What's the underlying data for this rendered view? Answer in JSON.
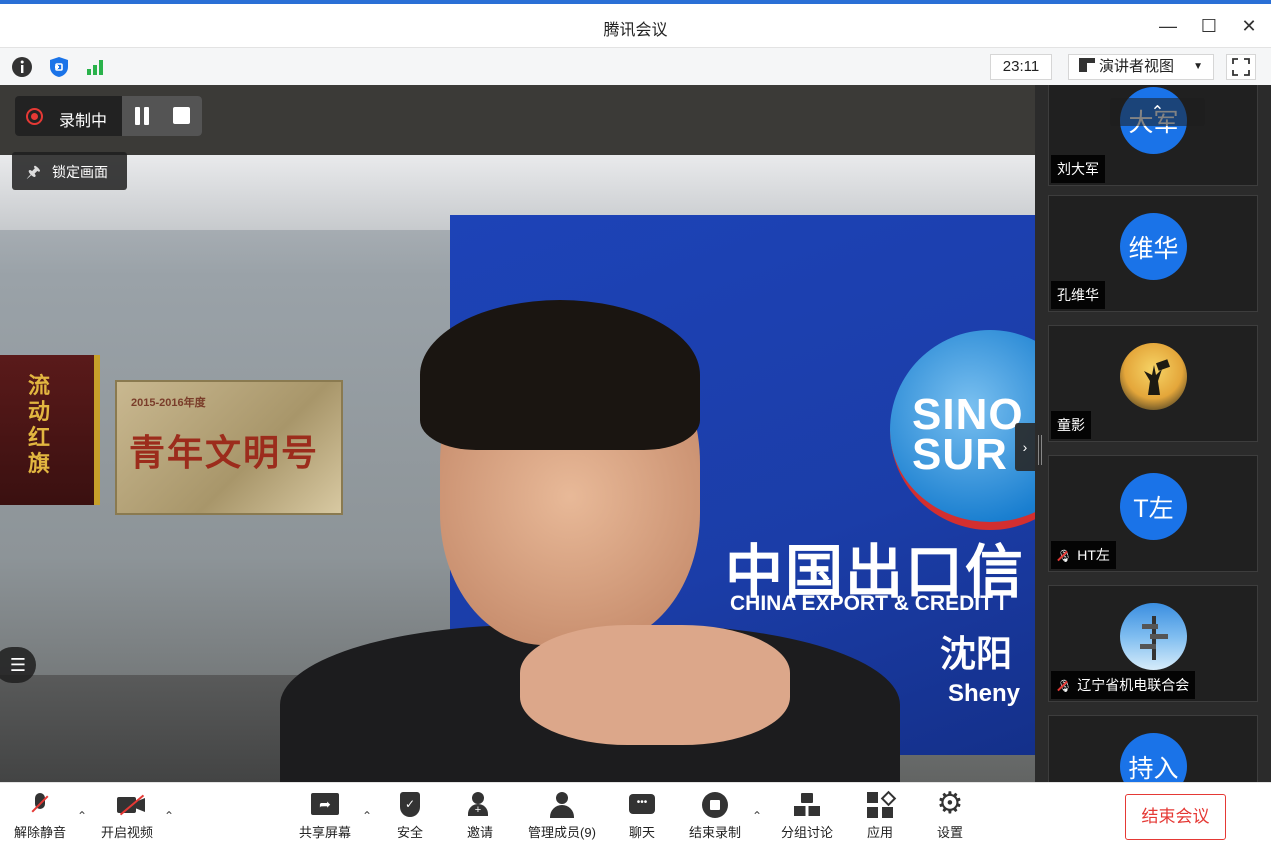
{
  "window": {
    "title": "腾讯会议",
    "minimize": "—",
    "maximize": "☐",
    "close": "✕"
  },
  "infobar": {
    "icons": [
      "info-icon",
      "shield-icon",
      "signal-icon"
    ],
    "timer": "23:11",
    "view_mode": "演讲者视图",
    "view_caret": "▼"
  },
  "stage": {
    "recording_label": "录制中",
    "lock_label": "锁定画面",
    "video_texts": {
      "globe": "SINO\nSURE",
      "cn": "中国出口信",
      "en": "CHINA EXPORT & CREDIT I",
      "city_cn": "沈阳",
      "city_en": "Sheny",
      "plaque_year": "2015-2016年度",
      "plaque_title": "青年文明号",
      "banner": "流动红旗"
    }
  },
  "participants": [
    {
      "avatar_text": "大军",
      "name": "刘大军",
      "muted": false
    },
    {
      "avatar_text": "维华",
      "name": "孔维华",
      "muted": false
    },
    {
      "avatar_text": "",
      "name": "童影",
      "muted": false,
      "avatar_image": "silhouette-sunset"
    },
    {
      "avatar_text": "T左",
      "name": "HT左",
      "muted": true
    },
    {
      "avatar_text": "",
      "name": "辽宁省机电联合会",
      "muted": true,
      "avatar_image": "signpost-sky"
    },
    {
      "avatar_text": "持入",
      "name": "",
      "muted": false
    }
  ],
  "toolbar": {
    "unmute": "解除静音",
    "start_video": "开启视频",
    "share_screen": "共享屏幕",
    "security": "安全",
    "invite": "邀请",
    "manage_members": "管理成员(9)",
    "chat": "聊天",
    "end_recording": "结束录制",
    "breakout": "分组讨论",
    "apps": "应用",
    "settings": "设置",
    "end_meeting": "结束会议"
  },
  "colors": {
    "accent": "#1a73e8",
    "danger": "#e53935",
    "title_accent": "#2a6fd6"
  }
}
